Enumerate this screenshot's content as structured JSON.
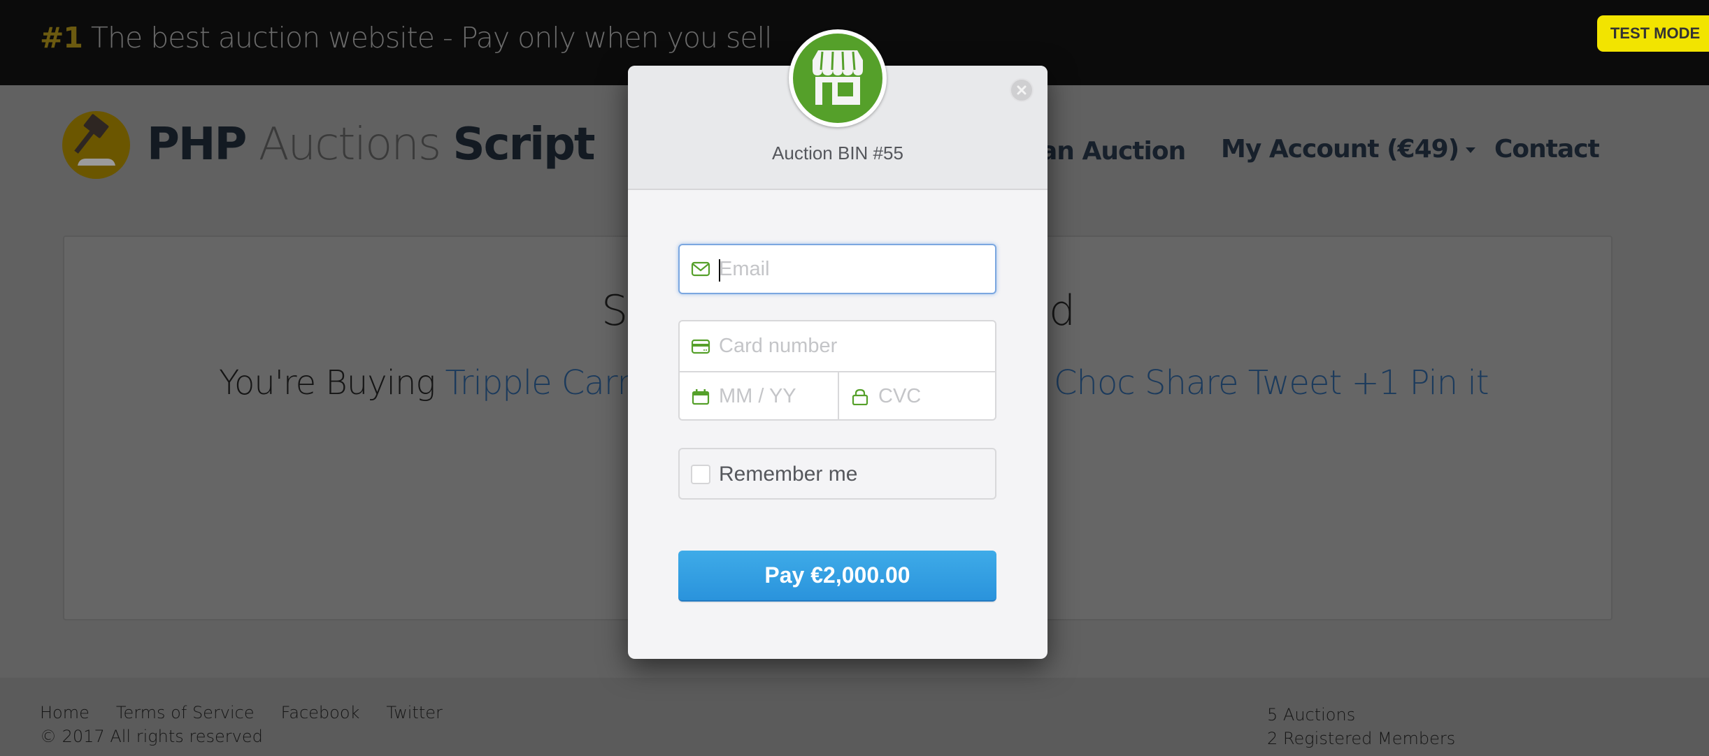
{
  "topbar": {
    "tagline_number": "#1",
    "tagline_text": " The best auction website - Pay only when you sell",
    "test_mode_badge": "TEST MODE"
  },
  "header": {
    "logo_icon": "gavel-icon",
    "logo_word1": "PHP",
    "logo_word2": " Auctions ",
    "logo_word3": "Script",
    "nav": {
      "create_auction_visible": "an Auction",
      "my_account": "My Account (€49)",
      "contact": "Contact"
    }
  },
  "main": {
    "heading_visible_start": "S",
    "heading_visible_end": "d",
    "buying_prefix": "You're Buying ",
    "item_link_visible_start": "Tripple Carri",
    "item_link_visible_end": "Choc",
    "share_links": [
      "Share",
      "Tweet",
      "+1",
      "Pin it"
    ]
  },
  "footer": {
    "links": [
      "Home",
      "Terms of Service",
      "Facebook",
      "Twitter"
    ],
    "copyright": "© 2017 All rights reserved",
    "stats": {
      "auctions": "5 Auctions",
      "members": "2 Registered Members"
    }
  },
  "modal": {
    "logo_icon": "storefront-icon",
    "title": "Auction BIN #55",
    "email": {
      "value": "",
      "placeholder": "Email",
      "icon": "envelope-icon"
    },
    "card_number": {
      "value": "",
      "placeholder": "Card number",
      "icon": "credit-card-icon"
    },
    "expiry": {
      "value": "",
      "placeholder": "MM / YY",
      "icon": "calendar-icon"
    },
    "cvc": {
      "value": "",
      "placeholder": "CVC",
      "icon": "lock-icon"
    },
    "remember_me": {
      "label": "Remember me",
      "checked": false
    },
    "pay_button": "Pay €2,000.00",
    "accent_color": "#55a02a",
    "button_color": "#2f9be0"
  }
}
